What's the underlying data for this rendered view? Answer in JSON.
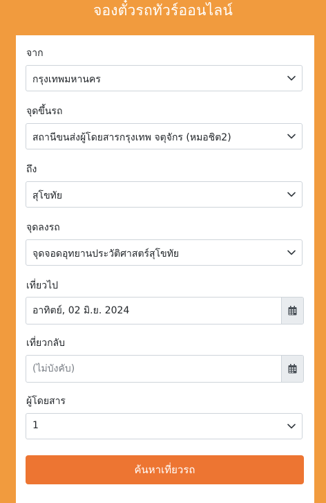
{
  "page_title": "จองตั๋วรถทัวร์ออนไลน์",
  "form": {
    "origin": {
      "label": "จาก",
      "value": "กรุงเทพมหานคร"
    },
    "pickup": {
      "label": "จุดขึ้นรถ",
      "value": "สถานีขนส่งผู้โดยสารกรุงเทพ จตุจักร (หมอชิต2)"
    },
    "destination": {
      "label": "ถึง",
      "value": "สุโขทัย"
    },
    "dropoff": {
      "label": "จุดลงรถ",
      "value": "จุดจอดอุทยานประวัติศาสตร์สุโขทัย"
    },
    "departure": {
      "label": "เที่ยวไป",
      "value": "อาทิตย์, 02 มิ.ย. 2024"
    },
    "return_trip": {
      "label": "เที่ยวกลับ",
      "value": "",
      "placeholder": "(ไม่บังคับ)"
    },
    "passengers": {
      "label": "ผู้โดยสาร",
      "value": "1"
    },
    "search_button": "ค้นหาเที่ยวรถ"
  },
  "icons": {
    "select_arrow": "chevron-down-icon",
    "date_picker": "calendar-icon"
  },
  "colors": {
    "background": "#F19B3E",
    "button": "#ED7532",
    "button_text": "#FFFFFF",
    "addon_background": "#E9ECEF",
    "border": "#CED4DA"
  }
}
